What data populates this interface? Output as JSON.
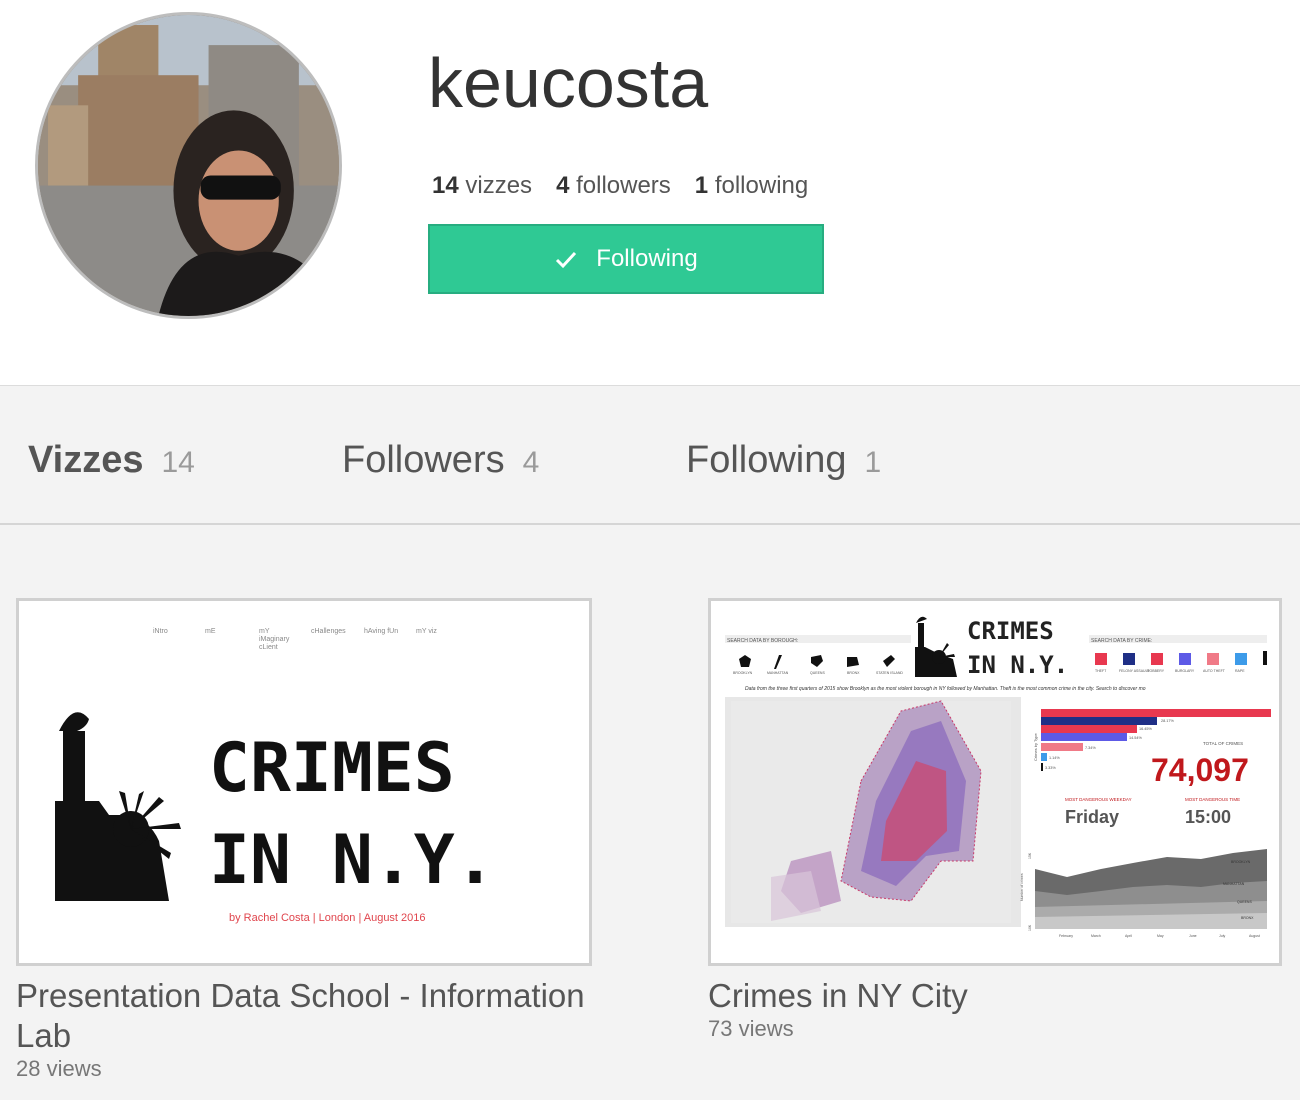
{
  "profile": {
    "username": "keucosta",
    "stats": {
      "vizzes_count": "14",
      "vizzes_label": "vizzes",
      "followers_count": "4",
      "followers_label": "followers",
      "following_count": "1",
      "following_label": "following"
    },
    "follow_button_label": "Following"
  },
  "tabs": [
    {
      "label": "Vizzes",
      "count": "14",
      "active": true
    },
    {
      "label": "Followers",
      "count": "4",
      "active": false
    },
    {
      "label": "Following",
      "count": "1",
      "active": false
    }
  ],
  "vizzes": [
    {
      "title": "Presentation Data School - Information Lab",
      "views": "28 views",
      "thumbnail": {
        "nav": [
          "iNtro",
          "mE",
          "mY iMaginary cLient",
          "cHallenges",
          "hAving fUn",
          "mY viz"
        ],
        "headline_1": "CRIMES",
        "headline_2": "IN N.Y.",
        "byline": "by Rachel Costa | London | August 2016"
      }
    },
    {
      "title": "Crimes in NY City",
      "views": "73 views",
      "thumbnail": {
        "headline_1": "CRIMES",
        "headline_2": "IN N.Y.",
        "search_borough": "SEARCH DATA BY BOROUGH:",
        "search_crime": "SEARCH DATA BY CRIME:",
        "boroughs": [
          "BROOKLYN",
          "MANHATTAN",
          "QUEENS",
          "BRONX",
          "STATEN ISLAND"
        ],
        "crimes": [
          "THEFT",
          "FELONY ASSAULT",
          "ROBBERY",
          "BURGLARY",
          "AUTO THEFT",
          "RAPE"
        ],
        "caption": "Data from the three first quarters of 2015 show Brooklyn as the most violent borough in NY followed by Manhattan. Theft is the most common crime in the city. Search to discover mo",
        "total_label": "TOTAL OF CRIMES",
        "total_value": "74,097",
        "weekday_label": "MOST DANGEROUS WEEKDAY",
        "weekday_value": "Friday",
        "time_label": "MOST DANGEROUS TIME",
        "time_value": "15:00",
        "bar_axis_label": "Crimes by Type",
        "bar_labels": [
          "28.17%",
          "16.45%",
          "14.54%",
          "7.34%",
          "1.14%",
          "3.33%"
        ],
        "area_labels": [
          "BROOKLYN",
          "MANHATTAN",
          "QUEENS",
          "BRONX"
        ],
        "area_axis_label": "Number of crimes",
        "area_ticks": [
          "15K",
          "10K"
        ],
        "months": [
          "February",
          "March",
          "April",
          "May",
          "June",
          "July",
          "August"
        ]
      }
    }
  ],
  "colors": {
    "follow_green": "#2fc994",
    "crime_red": "#c0181c",
    "bar_red": "#e8384f",
    "bar_navy": "#1f2f86",
    "bar_blue": "#5d5ae6"
  }
}
